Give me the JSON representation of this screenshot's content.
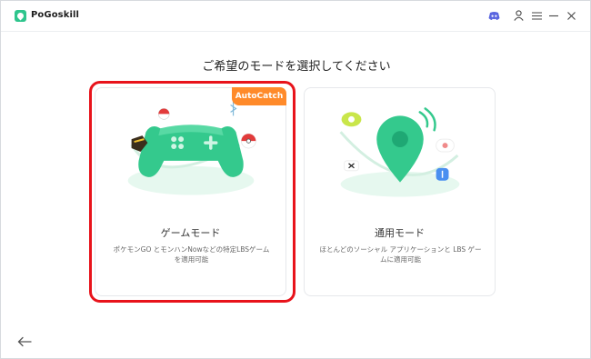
{
  "app": {
    "title": "PoGoskill"
  },
  "titlebar": {
    "icons": [
      "discord-icon",
      "user-icon",
      "menu-icon",
      "minimize-icon",
      "close-icon"
    ]
  },
  "heading": "ご希望のモードを選択してください",
  "cards": [
    {
      "badge": "AutoCatch",
      "title": "ゲームモード",
      "description": "ポケモンGO とモンハンNowなどの特定LBSゲームを適用可能",
      "selected": true
    },
    {
      "title": "通用モード",
      "description": "ほとんどのソーシャル アプリケーションと LBS ゲームに適用可能",
      "selected": false
    }
  ],
  "colors": {
    "accent": "#2fc58d",
    "badge": "#ff8a2a",
    "selection": "#e8131b"
  }
}
